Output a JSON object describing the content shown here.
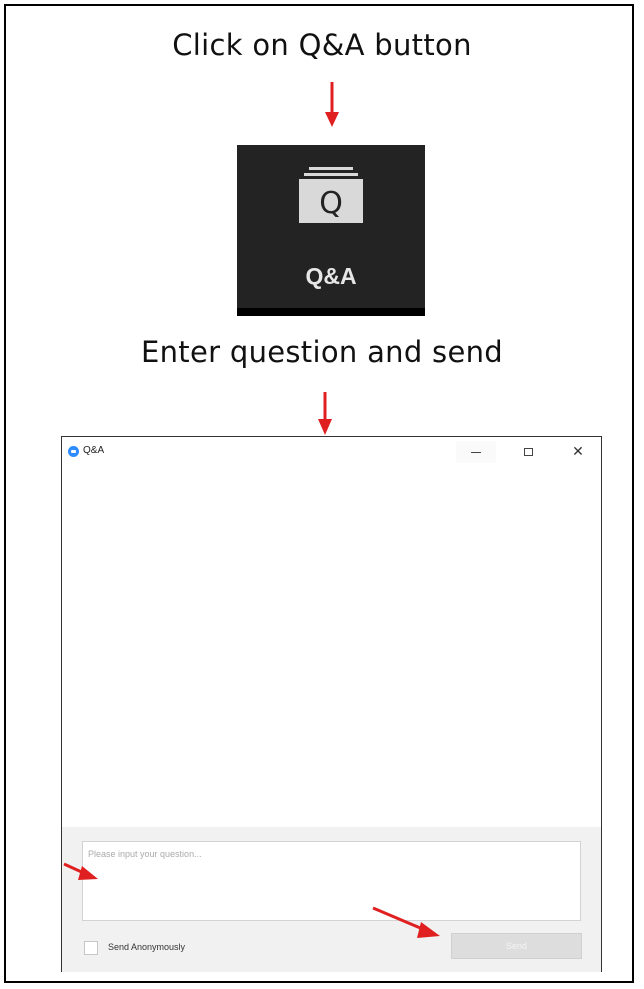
{
  "instructions": {
    "step1": "Click on Q&A button",
    "step2": "Enter question and send"
  },
  "qa_button": {
    "icon_letter": "Q",
    "label": "Q&A"
  },
  "dialog": {
    "title": "Q&A",
    "input_placeholder": "Please input your question...",
    "anonymous_label": "Send Anonymously",
    "anonymous_checked": false,
    "send_label": "Send"
  },
  "colors": {
    "arrow": "#e02020",
    "tile_background": "#232323",
    "app_logo": "#2d8cff"
  }
}
